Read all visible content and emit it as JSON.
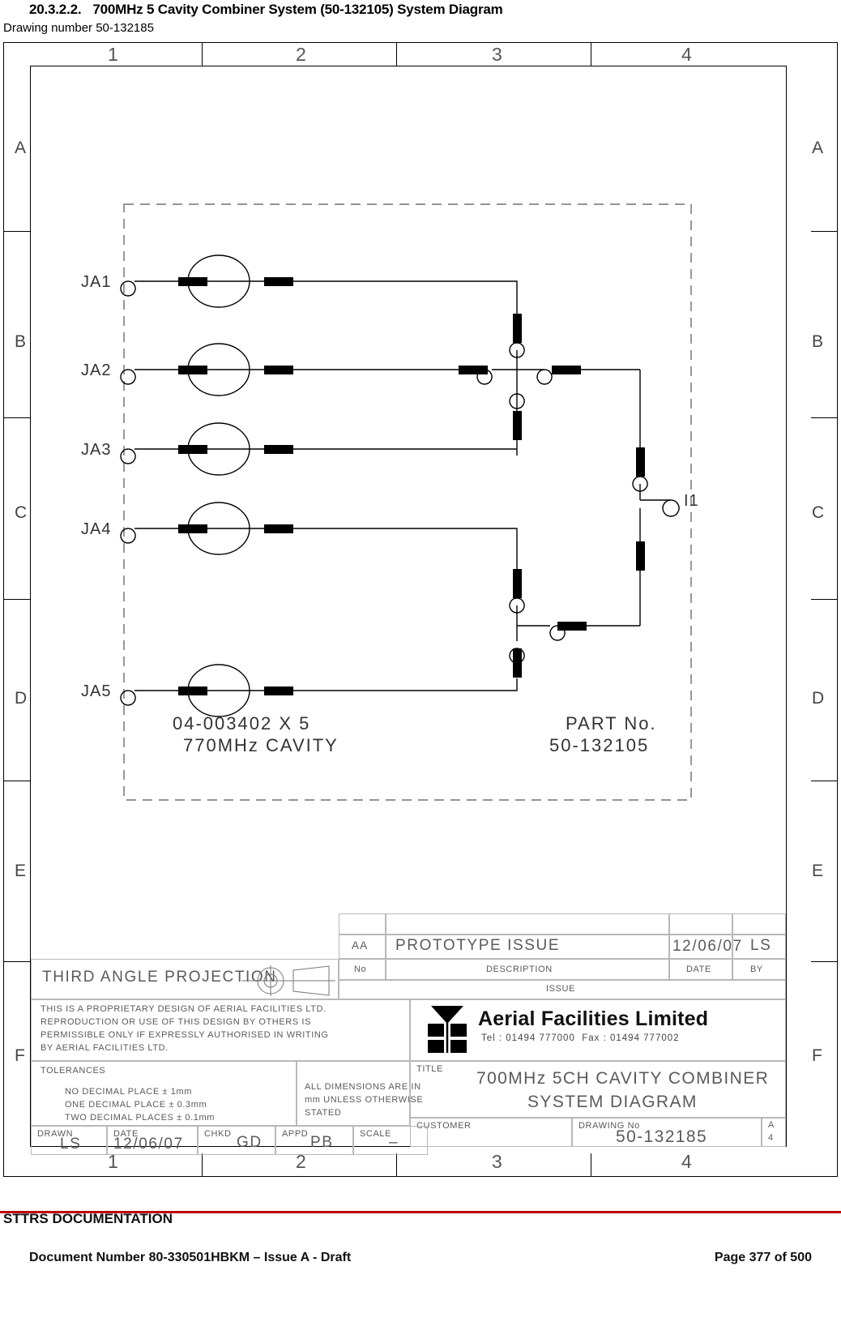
{
  "document": {
    "heading_number": "20.3.2.2.",
    "heading_text": "700MHz 5 Cavity Combiner System (50-132105) System Diagram",
    "drawing_number_line": "Drawing number 50-132185"
  },
  "frame": {
    "column_labels": [
      "1",
      "2",
      "3",
      "4"
    ],
    "row_labels": [
      "A",
      "B",
      "C",
      "D",
      "E",
      "F"
    ]
  },
  "schematic": {
    "port_labels": [
      "JA1",
      "JA2",
      "JA3",
      "JA4",
      "JA5"
    ],
    "output_label": "I1",
    "cavity_note_line1": "04-003402 X 5",
    "cavity_note_line2": "770MHz CAVITY",
    "part_no_label": "PART No.",
    "part_no_value": "50-132105"
  },
  "title_block": {
    "issue_table": {
      "header_label": "ISSUE",
      "columns": [
        "No",
        "DESCRIPTION",
        "DATE",
        "BY"
      ],
      "rows": [
        {
          "no": "AA",
          "description": "PROTOTYPE ISSUE",
          "date": "12/06/07",
          "by": "LS"
        }
      ]
    },
    "projection_label": "THIRD ANGLE PROJECTION",
    "proprietary_notice": [
      "THIS IS A PROPRIETARY DESIGN OF AERIAL FACILITIES LTD.",
      "REPRODUCTION OR USE OF THIS DESIGN BY OTHERS IS",
      "PERMISSIBLE ONLY IF EXPRESSLY AUTHORISED IN WRITING",
      "BY AERIAL FACILITIES LTD."
    ],
    "tolerances_label": "TOLERANCES",
    "tolerances": [
      "NO DECIMAL PLACE ± 1mm",
      "ONE DECIMAL PLACE ± 0.3mm",
      "TWO DECIMAL PLACES ± 0.1mm"
    ],
    "dimensions_note": [
      "ALL DIMENSIONS ARE IN",
      "mm UNLESS OTHERWISE",
      "STATED"
    ],
    "company": {
      "name": "Aerial Facilities Limited",
      "contact": "Tel : 01494 777000  Fax : 01494 777002"
    },
    "title_label": "TITLE",
    "title_line1": "700MHz 5CH CAVITY COMBINER",
    "title_line2": "SYSTEM DIAGRAM",
    "customer_label": "CUSTOMER",
    "customer_value": "",
    "drawing_no_label": "DRAWING No",
    "drawing_no_value": "50-132185",
    "sheet_size_line1": "A",
    "sheet_size_line2": "4",
    "fields": [
      {
        "label": "DRAWN",
        "value": "LS"
      },
      {
        "label": "DATE",
        "value": "12/06/07"
      },
      {
        "label": "CHKD",
        "value": "GD"
      },
      {
        "label": "APPD",
        "value": "PB"
      },
      {
        "label": "SCALE",
        "value": "–"
      }
    ]
  },
  "footer": {
    "rule_color": "#c00000",
    "title": "STTRS DOCUMENTATION",
    "document_number": "Document Number 80-330501HBKM – Issue A - Draft",
    "page": "Page 377 of 500"
  }
}
